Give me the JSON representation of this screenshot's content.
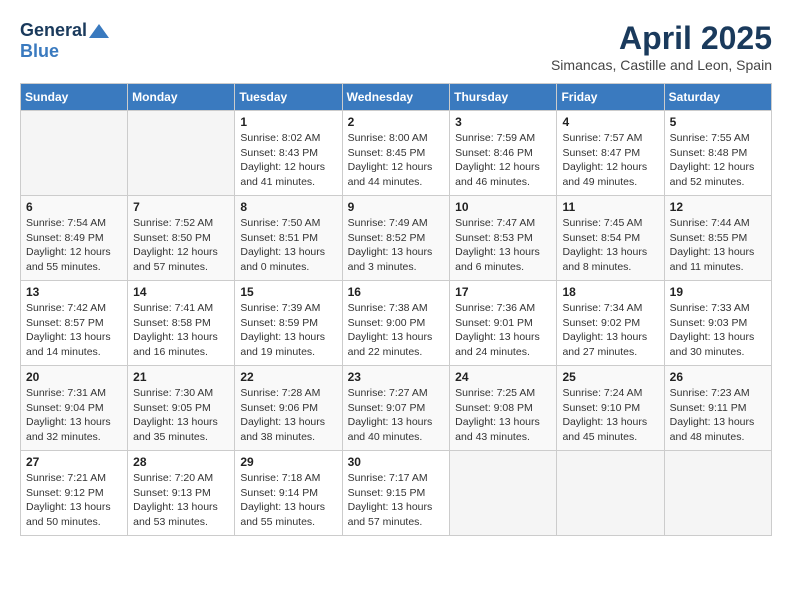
{
  "header": {
    "logo_general": "General",
    "logo_blue": "Blue",
    "month_title": "April 2025",
    "location": "Simancas, Castille and Leon, Spain"
  },
  "weekdays": [
    "Sunday",
    "Monday",
    "Tuesday",
    "Wednesday",
    "Thursday",
    "Friday",
    "Saturday"
  ],
  "weeks": [
    [
      {
        "day": "",
        "info": ""
      },
      {
        "day": "",
        "info": ""
      },
      {
        "day": "1",
        "info": "Sunrise: 8:02 AM\nSunset: 8:43 PM\nDaylight: 12 hours\nand 41 minutes."
      },
      {
        "day": "2",
        "info": "Sunrise: 8:00 AM\nSunset: 8:45 PM\nDaylight: 12 hours\nand 44 minutes."
      },
      {
        "day": "3",
        "info": "Sunrise: 7:59 AM\nSunset: 8:46 PM\nDaylight: 12 hours\nand 46 minutes."
      },
      {
        "day": "4",
        "info": "Sunrise: 7:57 AM\nSunset: 8:47 PM\nDaylight: 12 hours\nand 49 minutes."
      },
      {
        "day": "5",
        "info": "Sunrise: 7:55 AM\nSunset: 8:48 PM\nDaylight: 12 hours\nand 52 minutes."
      }
    ],
    [
      {
        "day": "6",
        "info": "Sunrise: 7:54 AM\nSunset: 8:49 PM\nDaylight: 12 hours\nand 55 minutes."
      },
      {
        "day": "7",
        "info": "Sunrise: 7:52 AM\nSunset: 8:50 PM\nDaylight: 12 hours\nand 57 minutes."
      },
      {
        "day": "8",
        "info": "Sunrise: 7:50 AM\nSunset: 8:51 PM\nDaylight: 13 hours\nand 0 minutes."
      },
      {
        "day": "9",
        "info": "Sunrise: 7:49 AM\nSunset: 8:52 PM\nDaylight: 13 hours\nand 3 minutes."
      },
      {
        "day": "10",
        "info": "Sunrise: 7:47 AM\nSunset: 8:53 PM\nDaylight: 13 hours\nand 6 minutes."
      },
      {
        "day": "11",
        "info": "Sunrise: 7:45 AM\nSunset: 8:54 PM\nDaylight: 13 hours\nand 8 minutes."
      },
      {
        "day": "12",
        "info": "Sunrise: 7:44 AM\nSunset: 8:55 PM\nDaylight: 13 hours\nand 11 minutes."
      }
    ],
    [
      {
        "day": "13",
        "info": "Sunrise: 7:42 AM\nSunset: 8:57 PM\nDaylight: 13 hours\nand 14 minutes."
      },
      {
        "day": "14",
        "info": "Sunrise: 7:41 AM\nSunset: 8:58 PM\nDaylight: 13 hours\nand 16 minutes."
      },
      {
        "day": "15",
        "info": "Sunrise: 7:39 AM\nSunset: 8:59 PM\nDaylight: 13 hours\nand 19 minutes."
      },
      {
        "day": "16",
        "info": "Sunrise: 7:38 AM\nSunset: 9:00 PM\nDaylight: 13 hours\nand 22 minutes."
      },
      {
        "day": "17",
        "info": "Sunrise: 7:36 AM\nSunset: 9:01 PM\nDaylight: 13 hours\nand 24 minutes."
      },
      {
        "day": "18",
        "info": "Sunrise: 7:34 AM\nSunset: 9:02 PM\nDaylight: 13 hours\nand 27 minutes."
      },
      {
        "day": "19",
        "info": "Sunrise: 7:33 AM\nSunset: 9:03 PM\nDaylight: 13 hours\nand 30 minutes."
      }
    ],
    [
      {
        "day": "20",
        "info": "Sunrise: 7:31 AM\nSunset: 9:04 PM\nDaylight: 13 hours\nand 32 minutes."
      },
      {
        "day": "21",
        "info": "Sunrise: 7:30 AM\nSunset: 9:05 PM\nDaylight: 13 hours\nand 35 minutes."
      },
      {
        "day": "22",
        "info": "Sunrise: 7:28 AM\nSunset: 9:06 PM\nDaylight: 13 hours\nand 38 minutes."
      },
      {
        "day": "23",
        "info": "Sunrise: 7:27 AM\nSunset: 9:07 PM\nDaylight: 13 hours\nand 40 minutes."
      },
      {
        "day": "24",
        "info": "Sunrise: 7:25 AM\nSunset: 9:08 PM\nDaylight: 13 hours\nand 43 minutes."
      },
      {
        "day": "25",
        "info": "Sunrise: 7:24 AM\nSunset: 9:10 PM\nDaylight: 13 hours\nand 45 minutes."
      },
      {
        "day": "26",
        "info": "Sunrise: 7:23 AM\nSunset: 9:11 PM\nDaylight: 13 hours\nand 48 minutes."
      }
    ],
    [
      {
        "day": "27",
        "info": "Sunrise: 7:21 AM\nSunset: 9:12 PM\nDaylight: 13 hours\nand 50 minutes."
      },
      {
        "day": "28",
        "info": "Sunrise: 7:20 AM\nSunset: 9:13 PM\nDaylight: 13 hours\nand 53 minutes."
      },
      {
        "day": "29",
        "info": "Sunrise: 7:18 AM\nSunset: 9:14 PM\nDaylight: 13 hours\nand 55 minutes."
      },
      {
        "day": "30",
        "info": "Sunrise: 7:17 AM\nSunset: 9:15 PM\nDaylight: 13 hours\nand 57 minutes."
      },
      {
        "day": "",
        "info": ""
      },
      {
        "day": "",
        "info": ""
      },
      {
        "day": "",
        "info": ""
      }
    ]
  ]
}
